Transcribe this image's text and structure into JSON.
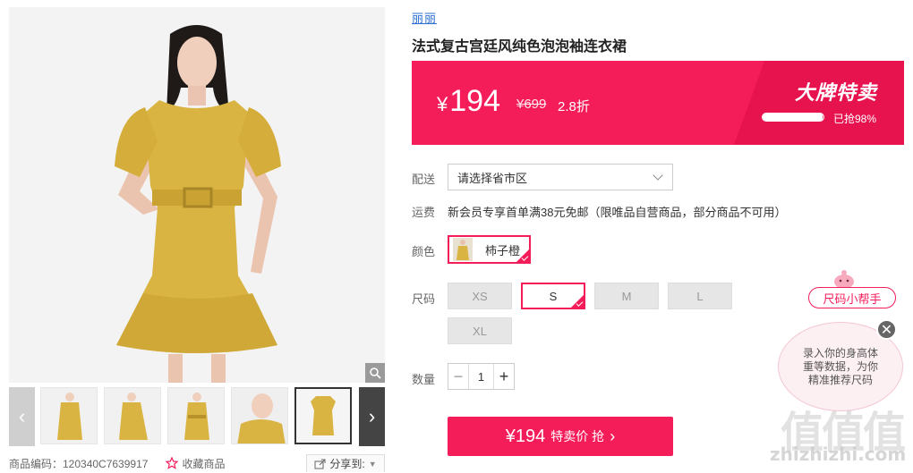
{
  "gallery": {
    "main_image": "dress-model-photo",
    "thumbnails": [
      "front-view",
      "side-view",
      "front-belted",
      "sleeve-detail",
      "flat-lay"
    ],
    "active_thumbnail": 5
  },
  "meta": {
    "product_code": "商品编码：120340C7639917",
    "favorite_label": "收藏商品",
    "share_label": "分享到:"
  },
  "product": {
    "brand": "丽丽",
    "title": "法式复古宫廷风纯色泡泡袖连衣裙"
  },
  "price": {
    "currency": "¥",
    "amount": "194",
    "original": "¥699",
    "discount": "2.8折",
    "promo_title": "大牌特卖",
    "sold_text": "已抢98%",
    "sold_fraction": 0.98
  },
  "delivery": {
    "label": "配送",
    "placeholder": "请选择省市区"
  },
  "shipping": {
    "label": "运费",
    "text": "新会员专享首单满38元免邮（限唯品自营商品，部分商品不可用）"
  },
  "color": {
    "label": "颜色",
    "options": [
      {
        "name": "柿子橙",
        "selected": true
      }
    ]
  },
  "size": {
    "label": "尺码",
    "options": [
      {
        "name": "XS",
        "selected": false
      },
      {
        "name": "S",
        "selected": true
      },
      {
        "name": "M",
        "selected": false
      },
      {
        "name": "L",
        "selected": false
      },
      {
        "name": "XL",
        "selected": false
      }
    ]
  },
  "quantity": {
    "label": "数量",
    "value": "1",
    "minus": "−",
    "plus": "+"
  },
  "buy": {
    "price": "¥194",
    "label": "特卖价 抢"
  },
  "size_helper": {
    "tag": "尺码小帮手",
    "bubble_text": "录入你的身高体重等数据，为你精准推荐尺码"
  },
  "watermark": {
    "chars": "值值值",
    "url": "zhizhizhi.com"
  },
  "colors": {
    "accent": "#f51c5a",
    "brand_link": "#2a6fd6",
    "dress": "#d9b443"
  }
}
